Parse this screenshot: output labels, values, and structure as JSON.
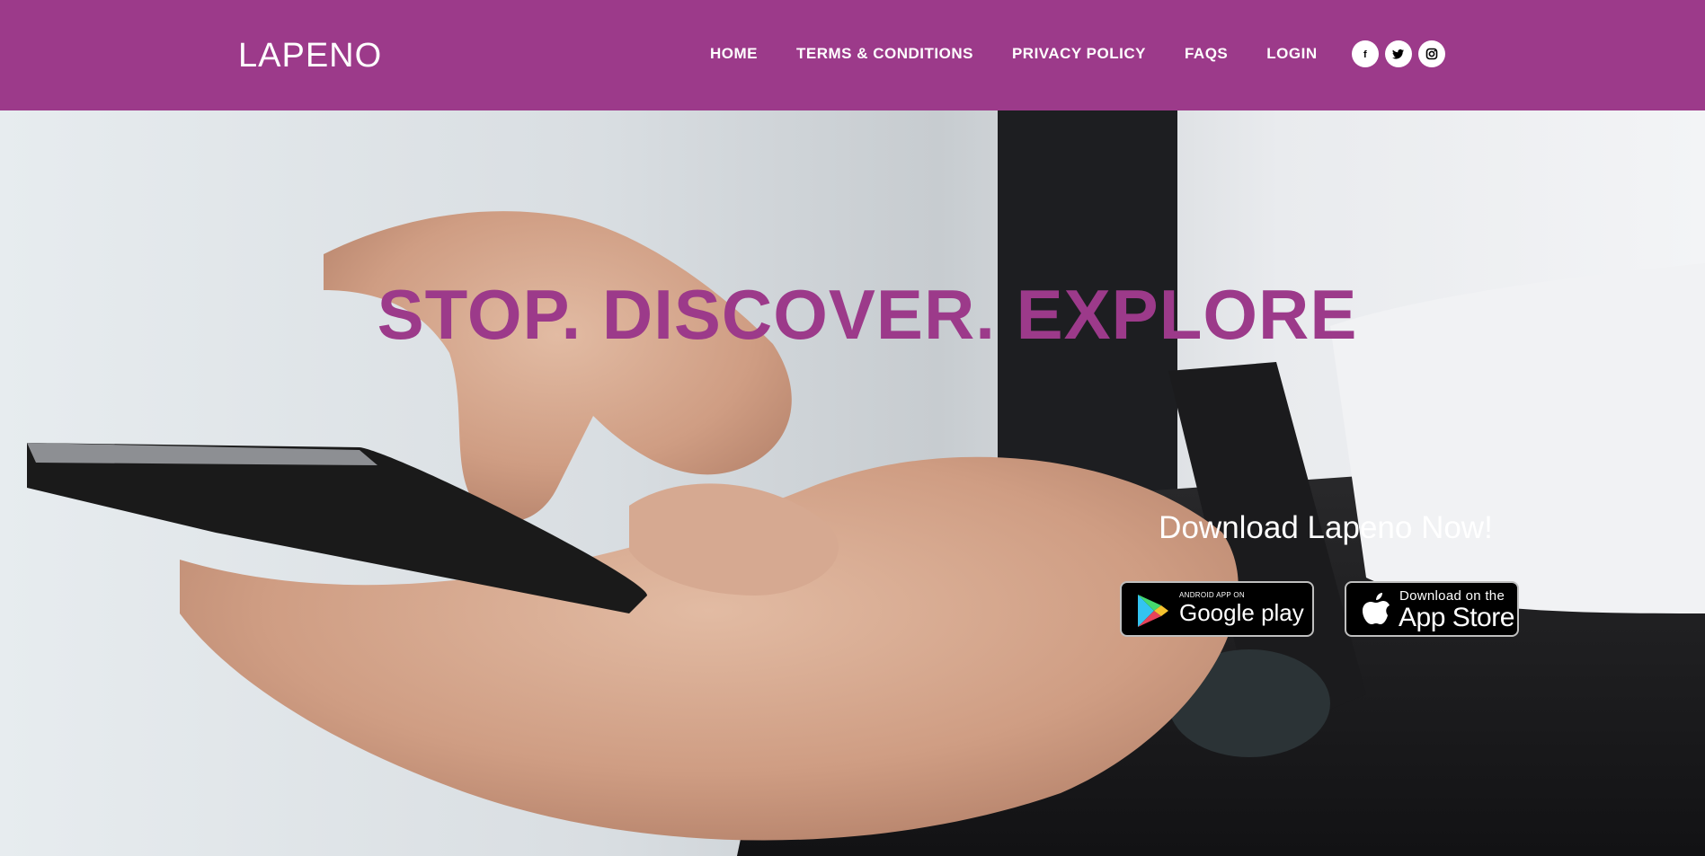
{
  "brand": {
    "logo_text": "LAPENO"
  },
  "colors": {
    "brand": "#9c3a8a",
    "nav_text": "#ffffff"
  },
  "nav": {
    "items": [
      {
        "label": "HOME"
      },
      {
        "label": "TERMS & CONDITIONS"
      },
      {
        "label": "PRIVACY POLICY"
      },
      {
        "label": "FAQS"
      },
      {
        "label": "LOGIN"
      }
    ],
    "socials": [
      {
        "icon": "facebook-icon",
        "glyph": "f"
      },
      {
        "icon": "twitter-icon",
        "glyph": ""
      },
      {
        "icon": "instagram-icon",
        "glyph": ""
      }
    ]
  },
  "hero": {
    "headline": "STOP. DISCOVER. EXPLORE",
    "download_title": "Download Lapeno Now!",
    "google_play": {
      "small": "ANDROID APP ON",
      "big": "Google play"
    },
    "app_store": {
      "small": "Download on the",
      "big": "App Store"
    }
  }
}
